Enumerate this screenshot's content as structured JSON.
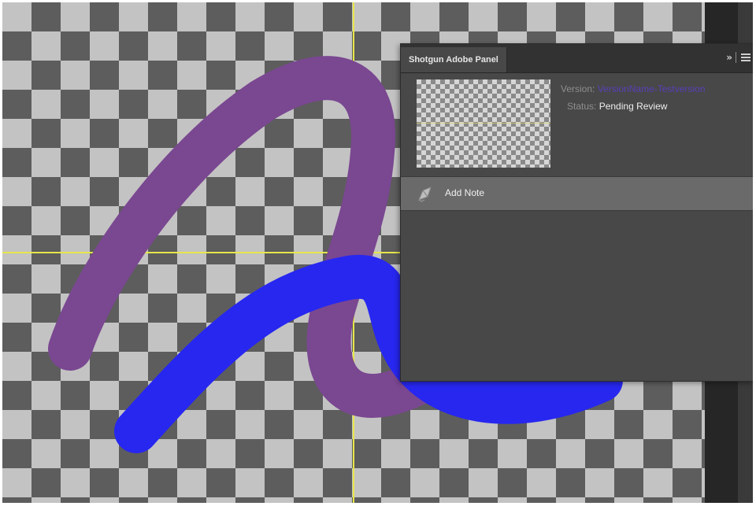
{
  "panel": {
    "title": "Shotgun Adobe Panel",
    "collapse_icon": "double-chevron-right-icon",
    "menu_icon": "hamburger-menu-icon",
    "version_label": "Version:",
    "version_value": "VersionName-Testversion",
    "status_label": "Status:",
    "status_value": "Pending Review",
    "add_note_label": "Add Note",
    "add_note_icon": "note-pen-icon",
    "collapse_text": "»"
  },
  "colors": {
    "purple_stroke": "#7a4791",
    "blue_stroke": "#2727f0",
    "guide_line": "#e6e64a",
    "checker_dark": "#5d5d5d",
    "checker_light": "#c3c3c3",
    "version_link": "#5a3fb8"
  }
}
